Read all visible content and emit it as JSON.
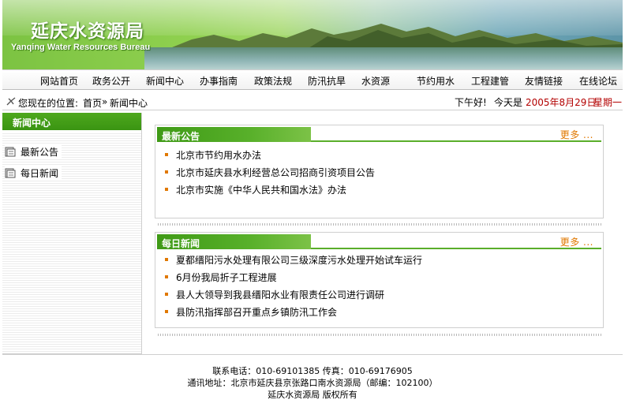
{
  "banner": {
    "title_cn": "延庆水资源局",
    "title_en": "Yanqing Water Resources Bureau"
  },
  "nav": {
    "items": [
      "网站首页",
      "政务公开",
      "新闻中心",
      "办事指南",
      "政策法规",
      "防汛抗旱",
      "水资源",
      "节约用水",
      "工程建管",
      "友情链接",
      "在线论坛"
    ]
  },
  "location": {
    "label": "您现在的位置:",
    "home": "首页",
    "separator": "»",
    "current": "新闻中心",
    "greeting": "下午好!",
    "today_label": "今天是",
    "date": "2005年8月29日",
    "weekday": "星期一"
  },
  "sidebar": {
    "title": "新闻中心",
    "items": [
      "最新公告",
      "每日新闻"
    ]
  },
  "panels": [
    {
      "title": "最新公告",
      "more": "更多 ...",
      "items": [
        "北京市节约用水办法",
        "北京市延庆县水利经营总公司招商引资项目公告",
        "北京市实施《中华人民共和国水法》办法"
      ]
    },
    {
      "title": "每日新闻",
      "more": "更多 ...",
      "items": [
        "夏都缙阳污水处理有限公司三级深度污水处理开始试车运行",
        "6月份我局折子工程进展",
        "县人大领导到我县缙阳水业有限责任公司进行调研",
        "县防汛指挥部召开重点乡镇防汛工作会"
      ]
    }
  ],
  "footer": {
    "phone": "联系电话：010-69101385 传真：010-69176905",
    "address": "通讯地址：北京市延庆县京张路口南水资源局（邮编：102100）",
    "copyright": "延庆水资源局 版权所有"
  },
  "colors": {
    "brand_green": "#3f9a16",
    "accent_orange": "#e07800",
    "date_red": "#b30000"
  }
}
